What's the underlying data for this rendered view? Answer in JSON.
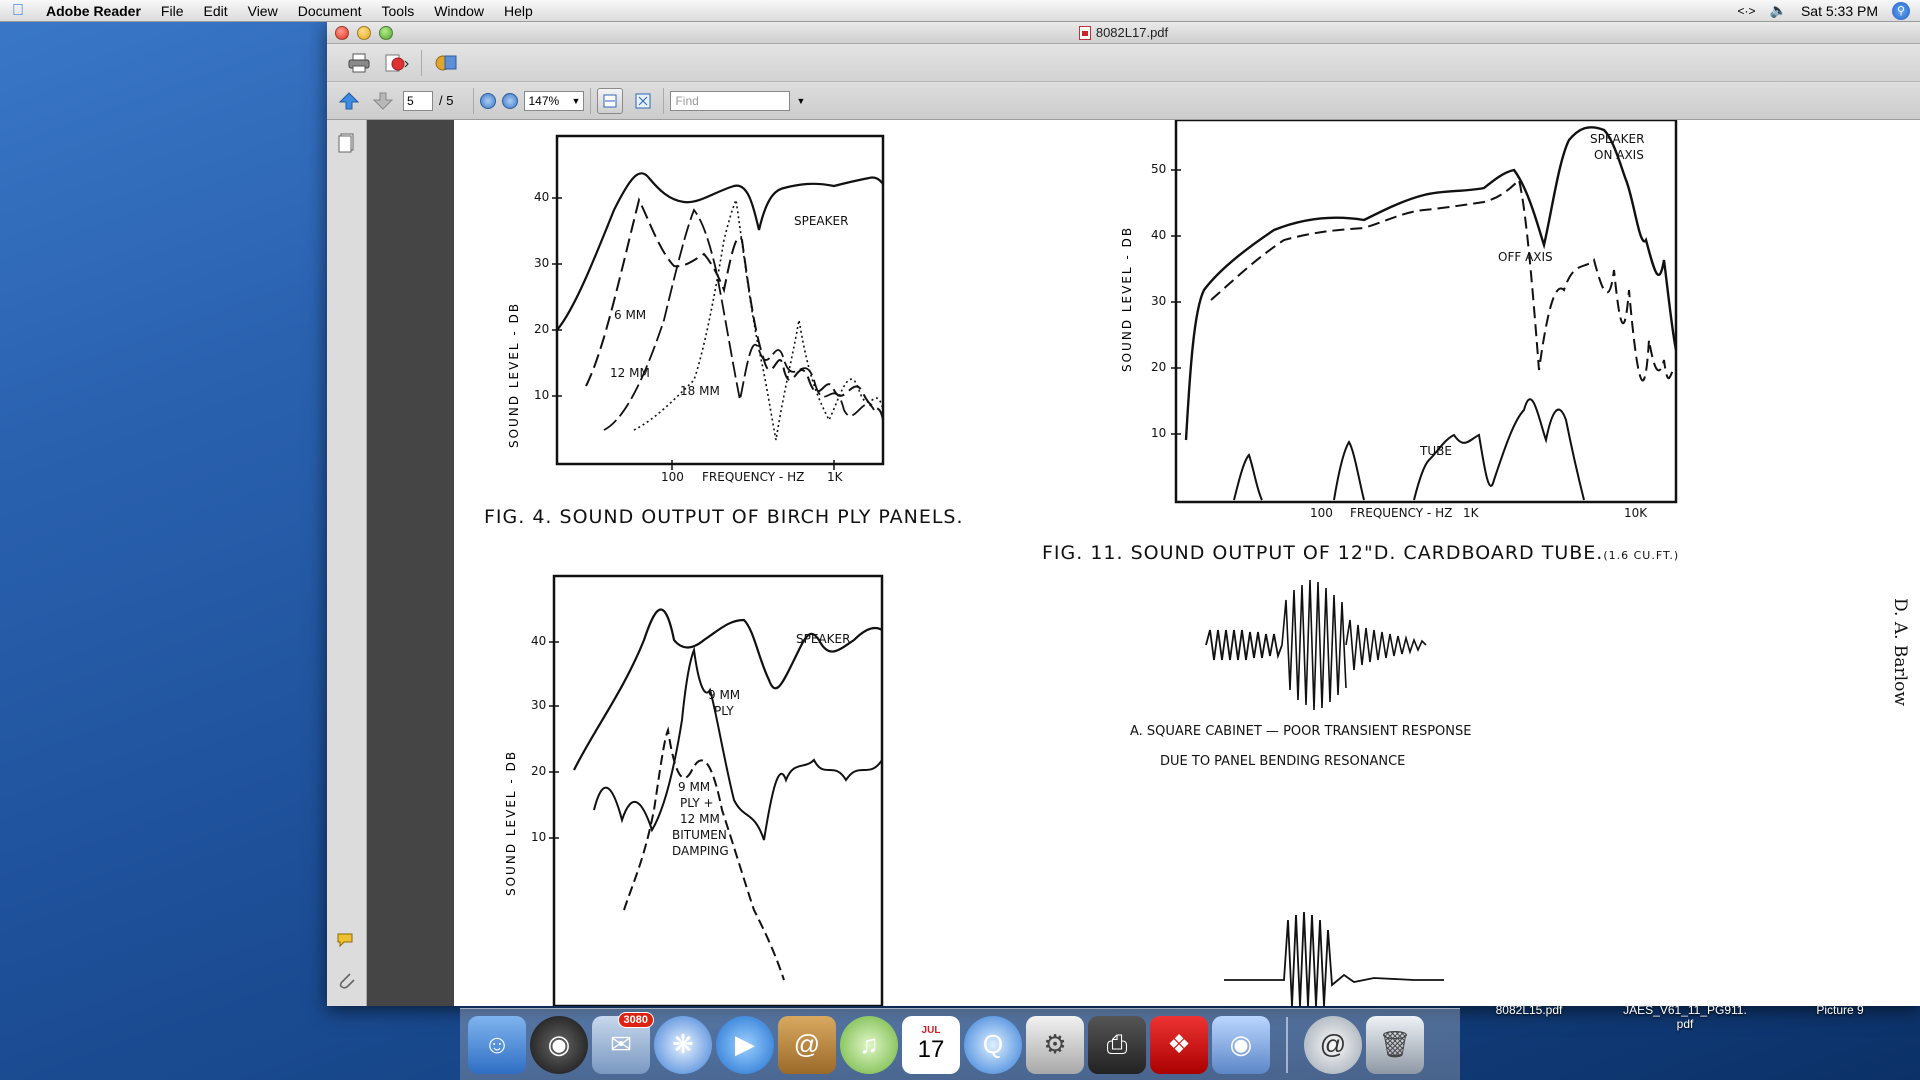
{
  "menubar": {
    "app": "Adobe Reader",
    "items": [
      "File",
      "Edit",
      "View",
      "Document",
      "Tools",
      "Window",
      "Help"
    ],
    "clock": "Sat 5:33 PM"
  },
  "window": {
    "title": "8082L17.pdf"
  },
  "toolbar": {
    "page_current": "5",
    "page_total": "/ 5",
    "zoom": "147%",
    "find_placeholder": "Find"
  },
  "document": {
    "fig4": {
      "caption": "FIG. 4.  SOUND  OUTPUT  OF  BIRCH  PLY  PANELS.",
      "ylabel": "SOUND   LEVEL  -  DB",
      "yticks": [
        "40",
        "30",
        "20",
        "10"
      ],
      "xticks": [
        "100",
        "1K"
      ],
      "xlabel": "FREQUENCY - HZ",
      "labels": [
        "SPEAKER",
        "6 MM",
        "12 MM",
        "18 MM"
      ]
    },
    "fig11": {
      "caption": "FIG. 11.  SOUND  OUTPUT  OF  12\"D.  CARDBOARD  TUBE.",
      "caption_note": "(1.6 CU.FT.)",
      "ylabel": "SOUND   LEVEL  -  DB",
      "yticks": [
        "50",
        "40",
        "30",
        "20",
        "10"
      ],
      "xticks": [
        "100",
        "1K",
        "10K"
      ],
      "xlabel": "FREQUENCY - HZ",
      "labels": [
        "SPEAKER",
        "ON AXIS",
        "OFF  AXIS",
        "TUBE"
      ]
    },
    "fig_bottom": {
      "ylabel": "SOUND   LEVEL  -  DB",
      "yticks": [
        "40",
        "30",
        "20",
        "10"
      ],
      "labels": [
        "SPEAKER",
        "9 MM",
        "PLY",
        "9 MM",
        "PLY +",
        "12 MM",
        "BITUMEN",
        "DAMPING"
      ]
    },
    "transient": {
      "line1": "A.    SQUARE    CABINET  —  POOR  TRANSIENT  RESPONSE",
      "line2": "DUE   TO   PANEL   BENDING   RESONANCE"
    },
    "author": "D. A. Barlow"
  },
  "dock": {
    "mail_badge": "3080",
    "calendar_month": "JUL",
    "calendar_day": "17"
  },
  "desktop_files": [
    {
      "name": "8082L15.pdf"
    },
    {
      "name": "JAES_V61_11_PG911.",
      "name2": "pdf"
    },
    {
      "name": "Picture 9"
    }
  ]
}
